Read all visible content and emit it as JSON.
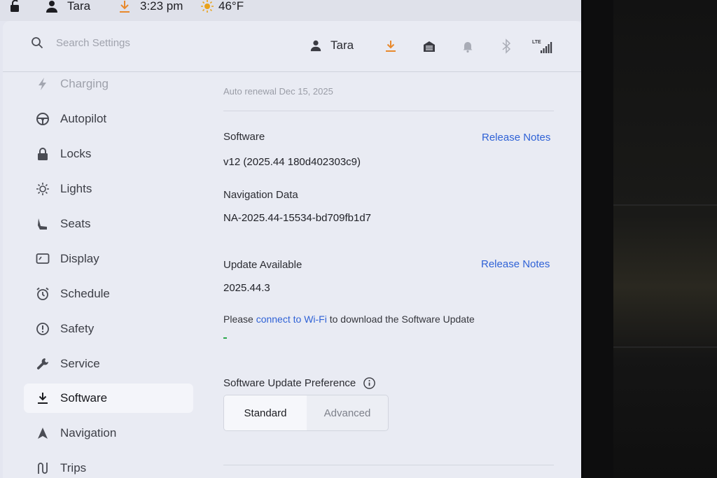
{
  "status_bar": {
    "user": "Tara",
    "time": "3:23 pm",
    "temperature": "46°F"
  },
  "header": {
    "search_placeholder": "Search Settings",
    "user": "Tara",
    "lte_label": "LTE",
    "download_color": "#e8892c"
  },
  "sidebar": {
    "items": [
      {
        "label": "Charging",
        "icon": "bolt-icon"
      },
      {
        "label": "Autopilot",
        "icon": "steering-wheel-icon"
      },
      {
        "label": "Locks",
        "icon": "lock-icon"
      },
      {
        "label": "Lights",
        "icon": "sun-icon"
      },
      {
        "label": "Seats",
        "icon": "seat-icon"
      },
      {
        "label": "Display",
        "icon": "display-icon"
      },
      {
        "label": "Schedule",
        "icon": "alarm-clock-icon"
      },
      {
        "label": "Safety",
        "icon": "alert-circle-icon"
      },
      {
        "label": "Service",
        "icon": "wrench-icon"
      },
      {
        "label": "Software",
        "icon": "download-icon",
        "active": true
      },
      {
        "label": "Navigation",
        "icon": "navigation-arrow-icon"
      },
      {
        "label": "Trips",
        "icon": "trips-icon"
      }
    ]
  },
  "content": {
    "auto_renewal": "Auto renewal Dec 15, 2025",
    "software_label": "Software",
    "release_notes_1": "Release Notes",
    "software_version": "v12 (2025.44 180d402303c9)",
    "nav_data_label": "Navigation Data",
    "nav_data_value": "NA-2025.44-15534-bd709fb1d7",
    "update_label": "Update Available",
    "release_notes_2": "Release Notes",
    "update_version": "2025.44.3",
    "wifi_prefix": "Please ",
    "wifi_link": "connect to Wi-Fi",
    "wifi_suffix": " to download the Software Update",
    "preference_label": "Software Update Preference",
    "pref_options": [
      "Standard",
      "Advanced"
    ],
    "pref_selected": "Standard",
    "accent_link_color": "#2f62d6"
  }
}
